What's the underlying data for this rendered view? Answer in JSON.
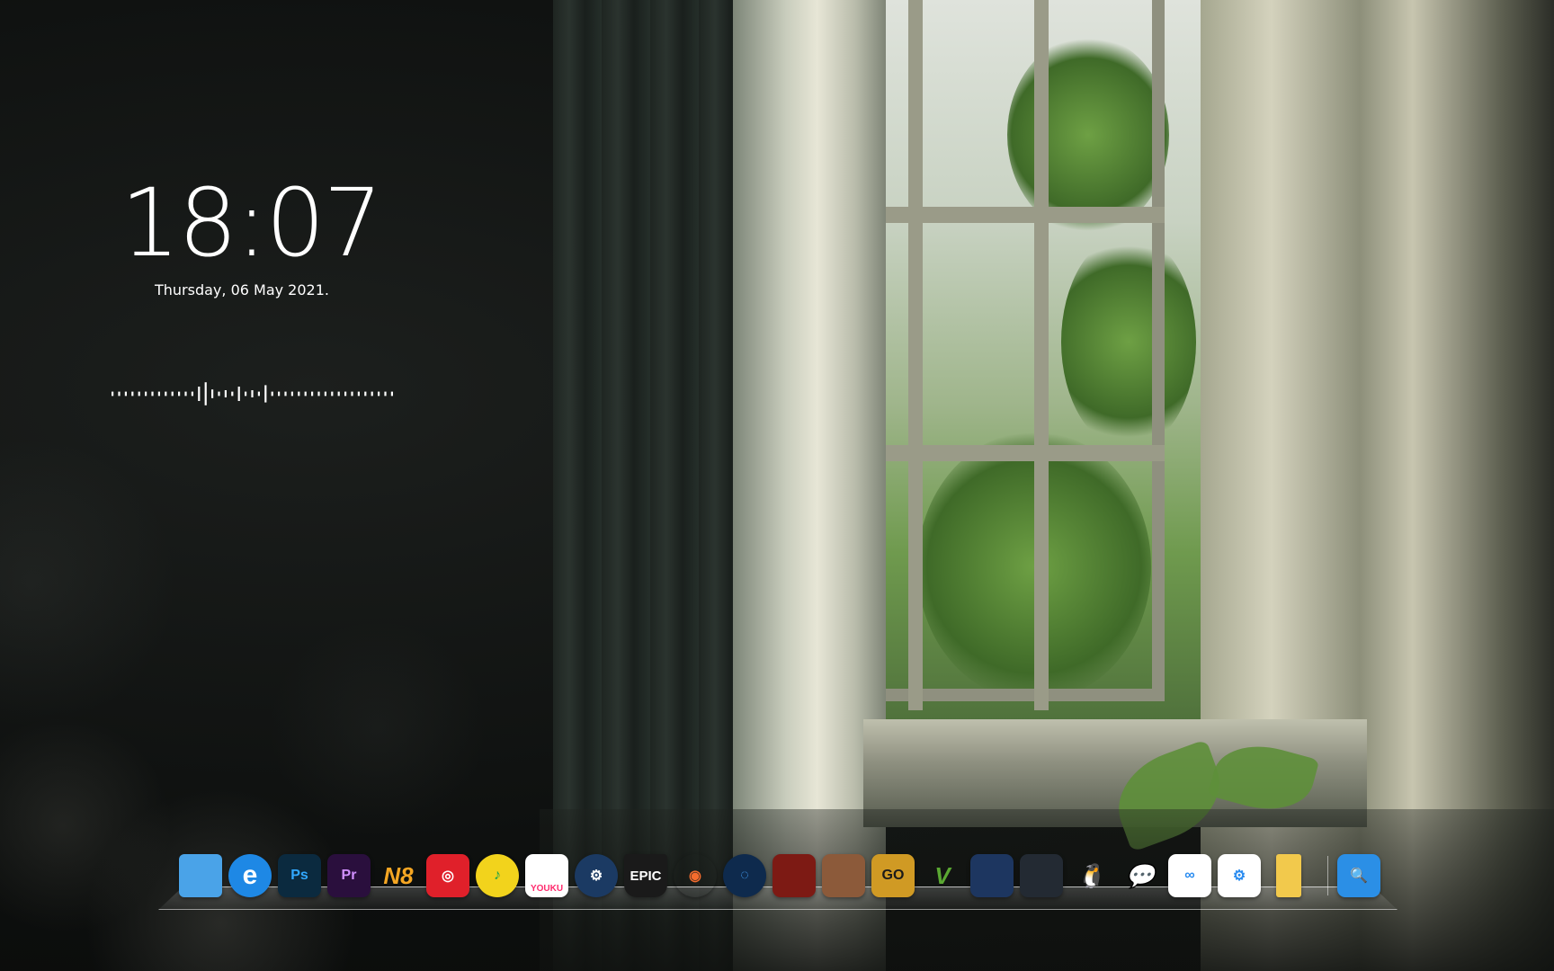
{
  "clock": {
    "time": "18:07",
    "date": "Thursday, 06 May 2021."
  },
  "visualizer": {
    "bars": [
      3,
      3,
      3,
      3,
      3,
      3,
      3,
      3,
      3,
      3,
      3,
      3,
      3,
      10,
      16,
      6,
      3,
      5,
      3,
      10,
      3,
      5,
      3,
      12,
      3,
      3,
      3,
      3,
      3,
      3,
      3,
      3,
      3,
      3,
      3,
      3,
      3,
      3,
      3,
      3,
      3,
      3,
      3
    ]
  },
  "dock": {
    "apps": [
      {
        "name": "file-explorer-icon",
        "label": "",
        "bg": "#4aa3e8",
        "fg": "#ffffff",
        "shape": "folder"
      },
      {
        "name": "internet-explorer-icon",
        "label": "e",
        "bg": "#1e88e5",
        "fg": "#ffffff",
        "shape": "circle"
      },
      {
        "name": "photoshop-icon",
        "label": "Ps",
        "bg": "#0b2a3f",
        "fg": "#31a8ff",
        "shape": "square"
      },
      {
        "name": "premiere-pro-icon",
        "label": "Pr",
        "bg": "#2a0f3d",
        "fg": "#d291ff",
        "shape": "square"
      },
      {
        "name": "n8-icon",
        "label": "N8",
        "bg": "transparent",
        "fg": "#f5a623",
        "shape": "text"
      },
      {
        "name": "netease-music-icon",
        "label": "◎",
        "bg": "#e0202a",
        "fg": "#ffffff",
        "shape": "square"
      },
      {
        "name": "qq-music-icon",
        "label": "♪",
        "bg": "#f2d31c",
        "fg": "#1ba24a",
        "shape": "circle"
      },
      {
        "name": "youku-icon",
        "label": "YOUKU",
        "bg": "#ffffff",
        "fg": "#ff2a6d",
        "shape": "square"
      },
      {
        "name": "steam-icon",
        "label": "⚙",
        "bg": "#1b3a63",
        "fg": "#ffffff",
        "shape": "circle"
      },
      {
        "name": "epic-games-icon",
        "label": "EPIC",
        "bg": "#1a1a1a",
        "fg": "#ffffff",
        "shape": "shield"
      },
      {
        "name": "origin-icon",
        "label": "◉",
        "bg": "transparent",
        "fg": "#f56c2d",
        "shape": "circle"
      },
      {
        "name": "uplay-icon",
        "label": "◌",
        "bg": "#0e2a4d",
        "fg": "#48a6ff",
        "shape": "circle"
      },
      {
        "name": "red-dead-redemption-icon",
        "label": "",
        "bg": "#7d1a14",
        "fg": "#ffffff",
        "shape": "square"
      },
      {
        "name": "game-character-icon",
        "label": "",
        "bg": "#8c5a3a",
        "fg": "#ffffff",
        "shape": "square"
      },
      {
        "name": "csgo-icon",
        "label": "GO",
        "bg": "#d09a24",
        "fg": "#1a1a1a",
        "shape": "square"
      },
      {
        "name": "gta-v-icon",
        "label": "V",
        "bg": "transparent",
        "fg": "#5aa832",
        "shape": "text"
      },
      {
        "name": "star-wars-icon",
        "label": "",
        "bg": "#1d3660",
        "fg": "#ffffff",
        "shape": "square"
      },
      {
        "name": "mortal-kombat-icon",
        "label": "",
        "bg": "#232a33",
        "fg": "#ffffff",
        "shape": "square"
      },
      {
        "name": "qq-icon",
        "label": "🐧",
        "bg": "transparent",
        "fg": "#111111",
        "shape": "text"
      },
      {
        "name": "wechat-icon",
        "label": "💬",
        "bg": "transparent",
        "fg": "#2dc100",
        "shape": "text"
      },
      {
        "name": "baidu-netdisk-icon",
        "label": "∞",
        "bg": "#ffffff",
        "fg": "#2a8cf0",
        "shape": "square"
      },
      {
        "name": "control-panel-icon",
        "label": "⚙",
        "bg": "#ffffff",
        "fg": "#2a8cf0",
        "shape": "square"
      },
      {
        "name": "yellow-folder-icon",
        "label": "",
        "bg": "#f2c94c",
        "fg": "#ffffff",
        "shape": "doc"
      },
      {
        "name": "search-icon",
        "label": "🔍",
        "bg": "#2b8fe6",
        "fg": "#ffffff",
        "shape": "square"
      }
    ]
  }
}
